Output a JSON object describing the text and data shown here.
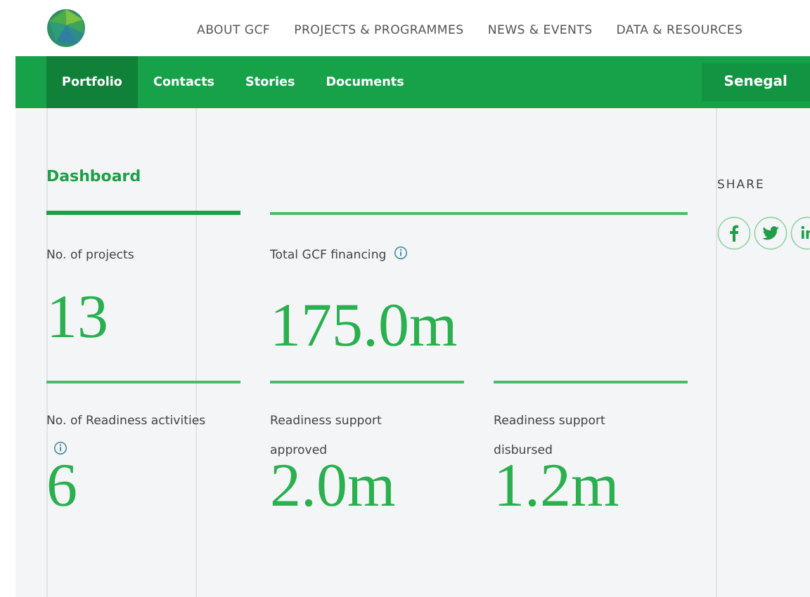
{
  "header": {
    "nav": [
      "ABOUT GCF",
      "PROJECTS & PROGRAMMES",
      "NEWS & EVENTS",
      "DATA & RESOURCES"
    ]
  },
  "tabs": [
    {
      "label": "Portfolio",
      "selected": true
    },
    {
      "label": "Contacts",
      "selected": false
    },
    {
      "label": "Stories",
      "selected": false
    },
    {
      "label": "Documents",
      "selected": false
    }
  ],
  "country": "Senegal",
  "dashboard": {
    "title": "Dashboard",
    "rows": [
      [
        {
          "kind": "normal",
          "label": "No. of projects",
          "value": "13",
          "info": false
        },
        {
          "kind": "wide",
          "label": "Total GCF financing",
          "value": "175.0m",
          "info": true
        }
      ],
      [
        {
          "kind": "normal",
          "label": "No. of Readiness activities",
          "value": "6",
          "info": true
        },
        {
          "kind": "normal",
          "label": "Readiness support approved",
          "value": "2.0m",
          "info": false
        },
        {
          "kind": "normal",
          "label": "Readiness support disbursed",
          "value": "1.2m",
          "info": false
        }
      ]
    ]
  },
  "share": {
    "title": "SHARE"
  }
}
